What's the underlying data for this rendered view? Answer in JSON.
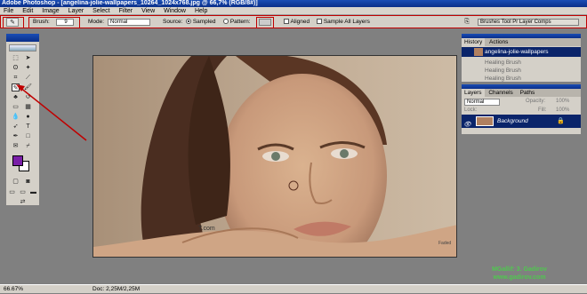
{
  "app": {
    "title": "Adobe Photoshop - [angelina-jolie-wallpapers_10264_1024x768.jpg @ 66,7% (RGB/8#)]"
  },
  "menu": [
    "File",
    "Edit",
    "Image",
    "Layer",
    "Select",
    "Filter",
    "View",
    "Window",
    "Help"
  ],
  "options": {
    "brush_label": "Brush:",
    "brush_size": "9",
    "mode_label": "Mode:",
    "mode_value": "Normal",
    "source_label": "Source:",
    "sampled_label": "Sampled",
    "pattern_label": "Pattern:",
    "aligned_label": "Aligned",
    "sample_all_label": "Sample All Layers",
    "palette_well": "Brushes  Tool Pr  Layer Comps"
  },
  "history": {
    "tabs": [
      "History",
      "Actions"
    ],
    "snapshot": "angelina-jolie-wallpapers",
    "items": [
      "Healing Brush",
      "Healing Brush",
      "Healing Brush"
    ]
  },
  "layers": {
    "tabs": [
      "Layers",
      "Channels",
      "Paths"
    ],
    "blend_mode": "Normal",
    "opacity_label": "Opacity:",
    "opacity_value": "100%",
    "lock_label": "Lock:",
    "fill_label": "Fill:",
    "fill_value": "100%",
    "background_layer": "Background"
  },
  "status": {
    "zoom": "66.67%",
    "doc": "Doc: 2,25M/2,25M"
  },
  "image_text": {
    "watermark_small": "Faded",
    "signature": "T.com"
  },
  "watermark": {
    "line1": "MGallif: 3. Gadirov",
    "line2": "www.gadirov.com"
  },
  "colors": {
    "foreground": "#7a1fa8",
    "background": "#ffffff",
    "highlight": "#c00000",
    "titlebar": "#0a2f8a"
  }
}
